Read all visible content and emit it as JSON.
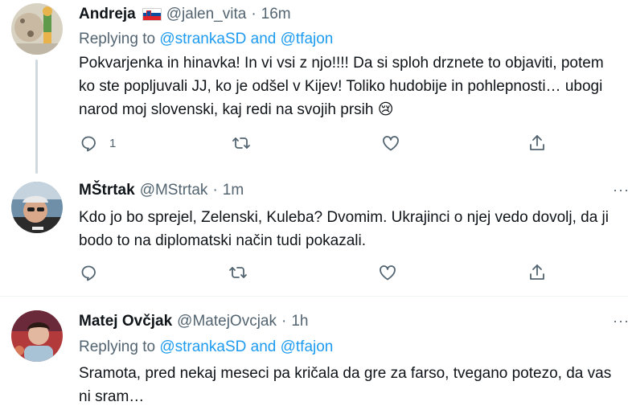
{
  "tweets": [
    {
      "name": "Andreja",
      "handle": "@jalen_vita",
      "separator": "·",
      "time": "16m",
      "replying_prefix": "Replying to",
      "replying_to_1": "@strankaSD",
      "replying_and": "and",
      "replying_to_2": "@tfajon",
      "text": "Pokvarjenka in hinavka! In vi vsi z njo!!!! Da si sploh drznete to objaviti, potem ko ste popljuvali JJ, ko je odšel v Kijev! Toliko hudobije in pohlepnosti… ubogi narod moj slovenski, kaj redi na svojih prsih 😢",
      "reply_count": "1"
    },
    {
      "name": "MŠtrtak",
      "handle": "@MStrtak",
      "separator": "·",
      "time": "1m",
      "text": "Kdo jo bo sprejel, Zelenski, Kuleba? Dvomim. Ukrajinci o njej vedo dovolj, da ji bodo to na diplomatski način tudi pokazali.",
      "more": "···"
    },
    {
      "name": "Matej Ovčjak",
      "handle": "@MatejOvcjak",
      "separator": "·",
      "time": "1h",
      "replying_prefix": "Replying to",
      "replying_to_1": "@strankaSD",
      "replying_and": "and",
      "replying_to_2": "@tfajon",
      "text": "Sramota, pred nekaj meseci pa kričala da gre za farso, tvegano potezo, da vas ni sram…",
      "more": "···"
    }
  ],
  "icons": {
    "reply": "reply-icon",
    "retweet": "retweet-icon",
    "like": "like-icon",
    "share": "share-icon",
    "more": "more-icon",
    "flag": "slovenia-flag-icon"
  },
  "colors": {
    "link": "#1d9bf0",
    "secondary_text": "#536471",
    "thread_line": "#cfd9de",
    "divider": "#eff3f4"
  }
}
